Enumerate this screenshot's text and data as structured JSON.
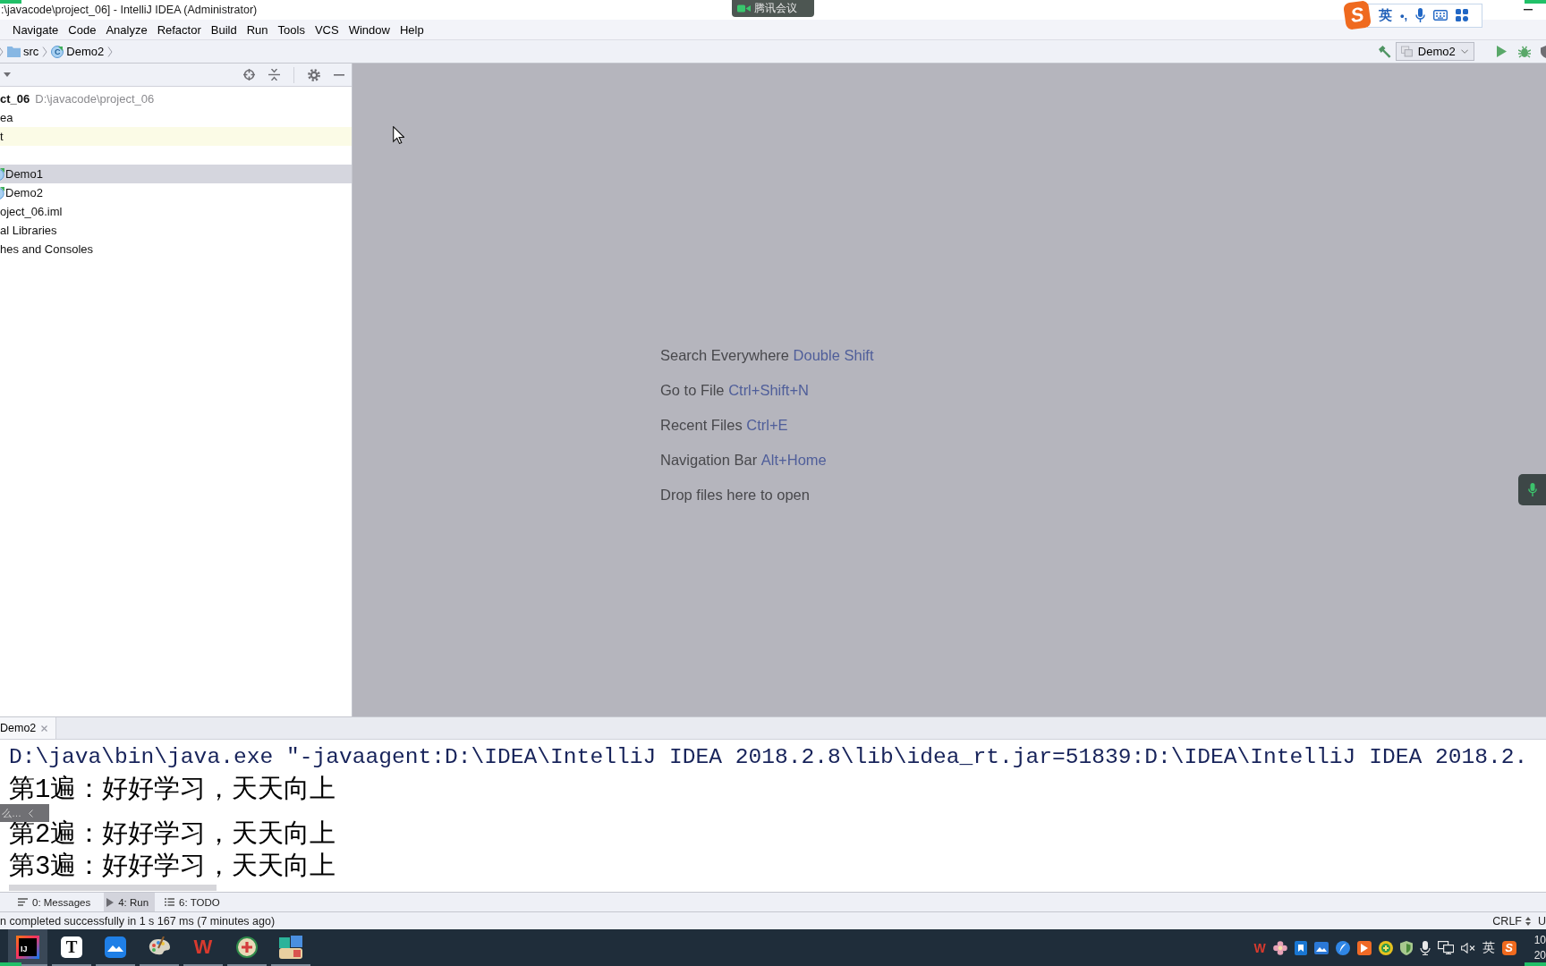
{
  "window": {
    "title": ":\\javacode\\project_06] - IntelliJ IDEA (Administrator)"
  },
  "meeting_bar": {
    "label": "腾讯会议"
  },
  "ime_toolbar": {
    "logo": "S",
    "language": "英",
    "punctuation": "•,"
  },
  "menu": [
    "Navigate",
    "Code",
    "Analyze",
    "Refactor",
    "Build",
    "Run",
    "Tools",
    "VCS",
    "Window",
    "Help"
  ],
  "breadcrumbs": [
    {
      "kind": "folder",
      "label": "src"
    },
    {
      "kind": "class",
      "glyph": "C",
      "label": "Demo2"
    }
  ],
  "run_config": {
    "label": "Demo2"
  },
  "project_tree": [
    {
      "kind": "project",
      "label": "ct_06",
      "path": "D:\\javacode\\project_06",
      "selected": false,
      "highlighted": false
    },
    {
      "kind": "folder",
      "label": "ea",
      "selected": false,
      "highlighted": false
    },
    {
      "kind": "folder",
      "label": "t",
      "selected": false,
      "highlighted": true
    },
    {
      "kind": "folder",
      "selected": false,
      "highlighted": false,
      "children": [
        {
          "kind": "class",
          "label": "Demo1",
          "selected": true,
          "highlighted": false
        },
        {
          "kind": "class",
          "label": "Demo2",
          "selected": false,
          "highlighted": false
        }
      ]
    },
    {
      "kind": "file",
      "label": "oject_06.iml",
      "selected": false,
      "highlighted": false
    },
    {
      "kind": "libraries",
      "label": "al Libraries",
      "selected": false,
      "highlighted": false
    },
    {
      "kind": "scratches",
      "label": "hes and Consoles",
      "selected": false,
      "highlighted": false
    }
  ],
  "welcome_hints": [
    {
      "text": "Search Everywhere",
      "shortcut": "Double Shift"
    },
    {
      "text": "Go to File",
      "shortcut": "Ctrl+Shift+N"
    },
    {
      "text": "Recent Files",
      "shortcut": "Ctrl+E"
    },
    {
      "text": "Navigation Bar",
      "shortcut": "Alt+Home"
    },
    {
      "text": "Drop files here to open"
    }
  ],
  "run_panel": {
    "tabs": [
      {
        "label": "Demo2",
        "selected": true
      }
    ],
    "console_lines": [
      {
        "kind": "command",
        "text": "D:\\java\\bin\\java.exe \"-javaagent:D:\\IDEA\\IntelliJ IDEA 2018.2.8\\lib\\idea_rt.jar=51839:D:\\IDEA\\IntelliJ IDEA 2018.2."
      },
      {
        "kind": "output",
        "text": "第1遍：好好学习，天天向上"
      },
      {
        "kind": "output",
        "text": "第2遍：好好学习，天天向上"
      },
      {
        "kind": "output",
        "text": "第3遍：好好学习，天天向上"
      }
    ],
    "popup": {
      "label": "么…"
    }
  },
  "tool_windows": [
    {
      "kind": "messages",
      "label": "0: Messages",
      "selected": false
    },
    {
      "kind": "run",
      "label": "4: Run",
      "selected": true
    },
    {
      "kind": "todo",
      "label": "6: TODO",
      "selected": false
    }
  ],
  "status_bar": {
    "message": "n completed successfully in 1 s 167 ms (7 minutes ago)",
    "line_separator": "CRLF",
    "encoding": "U"
  },
  "taskbar": {
    "apps": [
      {
        "kind": "ide",
        "glyph": "IJ",
        "selected": true
      },
      {
        "kind": "notes",
        "glyph": "T",
        "selected": false
      },
      {
        "kind": "cloud",
        "selected": false
      },
      {
        "kind": "palette",
        "selected": false
      },
      {
        "kind": "office",
        "glyph": "W",
        "selected": false
      },
      {
        "kind": "game",
        "selected": false
      },
      {
        "kind": "gallery",
        "selected": false
      }
    ],
    "tray": [
      {
        "kind": "office",
        "glyph": "W"
      },
      {
        "kind": "flower"
      },
      {
        "kind": "tile"
      },
      {
        "kind": "mountain"
      },
      {
        "kind": "feather"
      },
      {
        "kind": "flag"
      },
      {
        "kind": "plus"
      },
      {
        "kind": "shield"
      },
      {
        "kind": "mic"
      },
      {
        "kind": "network"
      },
      {
        "kind": "mute"
      },
      {
        "kind": "ime",
        "glyph": "英"
      },
      {
        "kind": "sogou",
        "glyph": "S"
      }
    ],
    "clock": [
      "10",
      "20"
    ]
  }
}
